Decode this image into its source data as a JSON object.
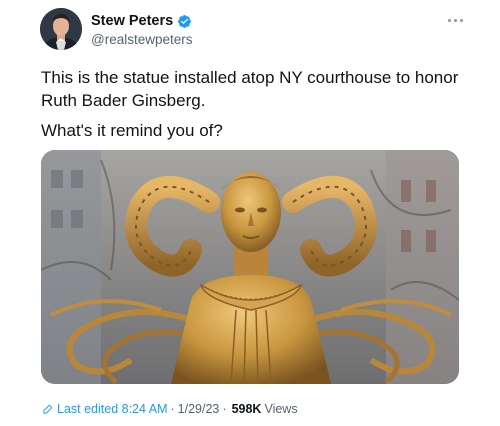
{
  "author": {
    "name": "Stew Peters",
    "handle": "@realstewpeters",
    "verified_color": "#1d9bf0"
  },
  "tweet": {
    "line1": "This is the statue installed atop NY courthouse to honor Ruth Bader Ginsberg.",
    "line2": "What's it remind you of?"
  },
  "meta": {
    "edited_label": "Last edited 8:24 AM",
    "date": "1/29/23",
    "separator": "·",
    "views_count": "598K",
    "views_label": "Views"
  },
  "icons": {
    "more": "more-icon",
    "verified": "verified-badge-icon",
    "edit": "pencil-icon"
  },
  "colors": {
    "accent": "#1d9bf0",
    "text": "#0f1419",
    "secondary": "#536471",
    "statue_gold": "#c8963e"
  }
}
